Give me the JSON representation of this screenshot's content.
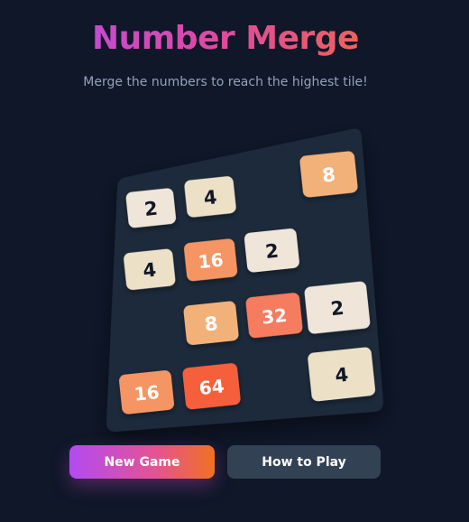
{
  "header": {
    "title": "Number Merge",
    "subtitle": "Merge the numbers to reach the highest tile!"
  },
  "board": {
    "rows": 4,
    "cols": 4,
    "tiles": [
      {
        "row": 0,
        "col": 0,
        "value": 2
      },
      {
        "row": 0,
        "col": 1,
        "value": 4
      },
      {
        "row": 0,
        "col": 3,
        "value": 8
      },
      {
        "row": 1,
        "col": 0,
        "value": 4
      },
      {
        "row": 1,
        "col": 1,
        "value": 16
      },
      {
        "row": 1,
        "col": 2,
        "value": 2
      },
      {
        "row": 2,
        "col": 1,
        "value": 8
      },
      {
        "row": 2,
        "col": 2,
        "value": 32
      },
      {
        "row": 2,
        "col": 3,
        "value": 2
      },
      {
        "row": 3,
        "col": 0,
        "value": 16
      },
      {
        "row": 3,
        "col": 1,
        "value": 64
      },
      {
        "row": 3,
        "col": 3,
        "value": 4
      }
    ]
  },
  "tile_colors": {
    "2": {
      "bg": "#efe5d8",
      "fg": "#111827"
    },
    "4": {
      "bg": "#ece0c7",
      "fg": "#111827"
    },
    "8": {
      "bg": "#f2b179",
      "fg": "#ffffff"
    },
    "16": {
      "bg": "#f59563",
      "fg": "#ffffff"
    },
    "32": {
      "bg": "#f67c5f",
      "fg": "#ffffff"
    },
    "64": {
      "bg": "#f65e3b",
      "fg": "#ffffff"
    }
  },
  "buttons": {
    "new_game": "New Game",
    "how_to_play": "How to Play"
  },
  "colors": {
    "background": "#0f1729",
    "board": "#1e293b"
  }
}
